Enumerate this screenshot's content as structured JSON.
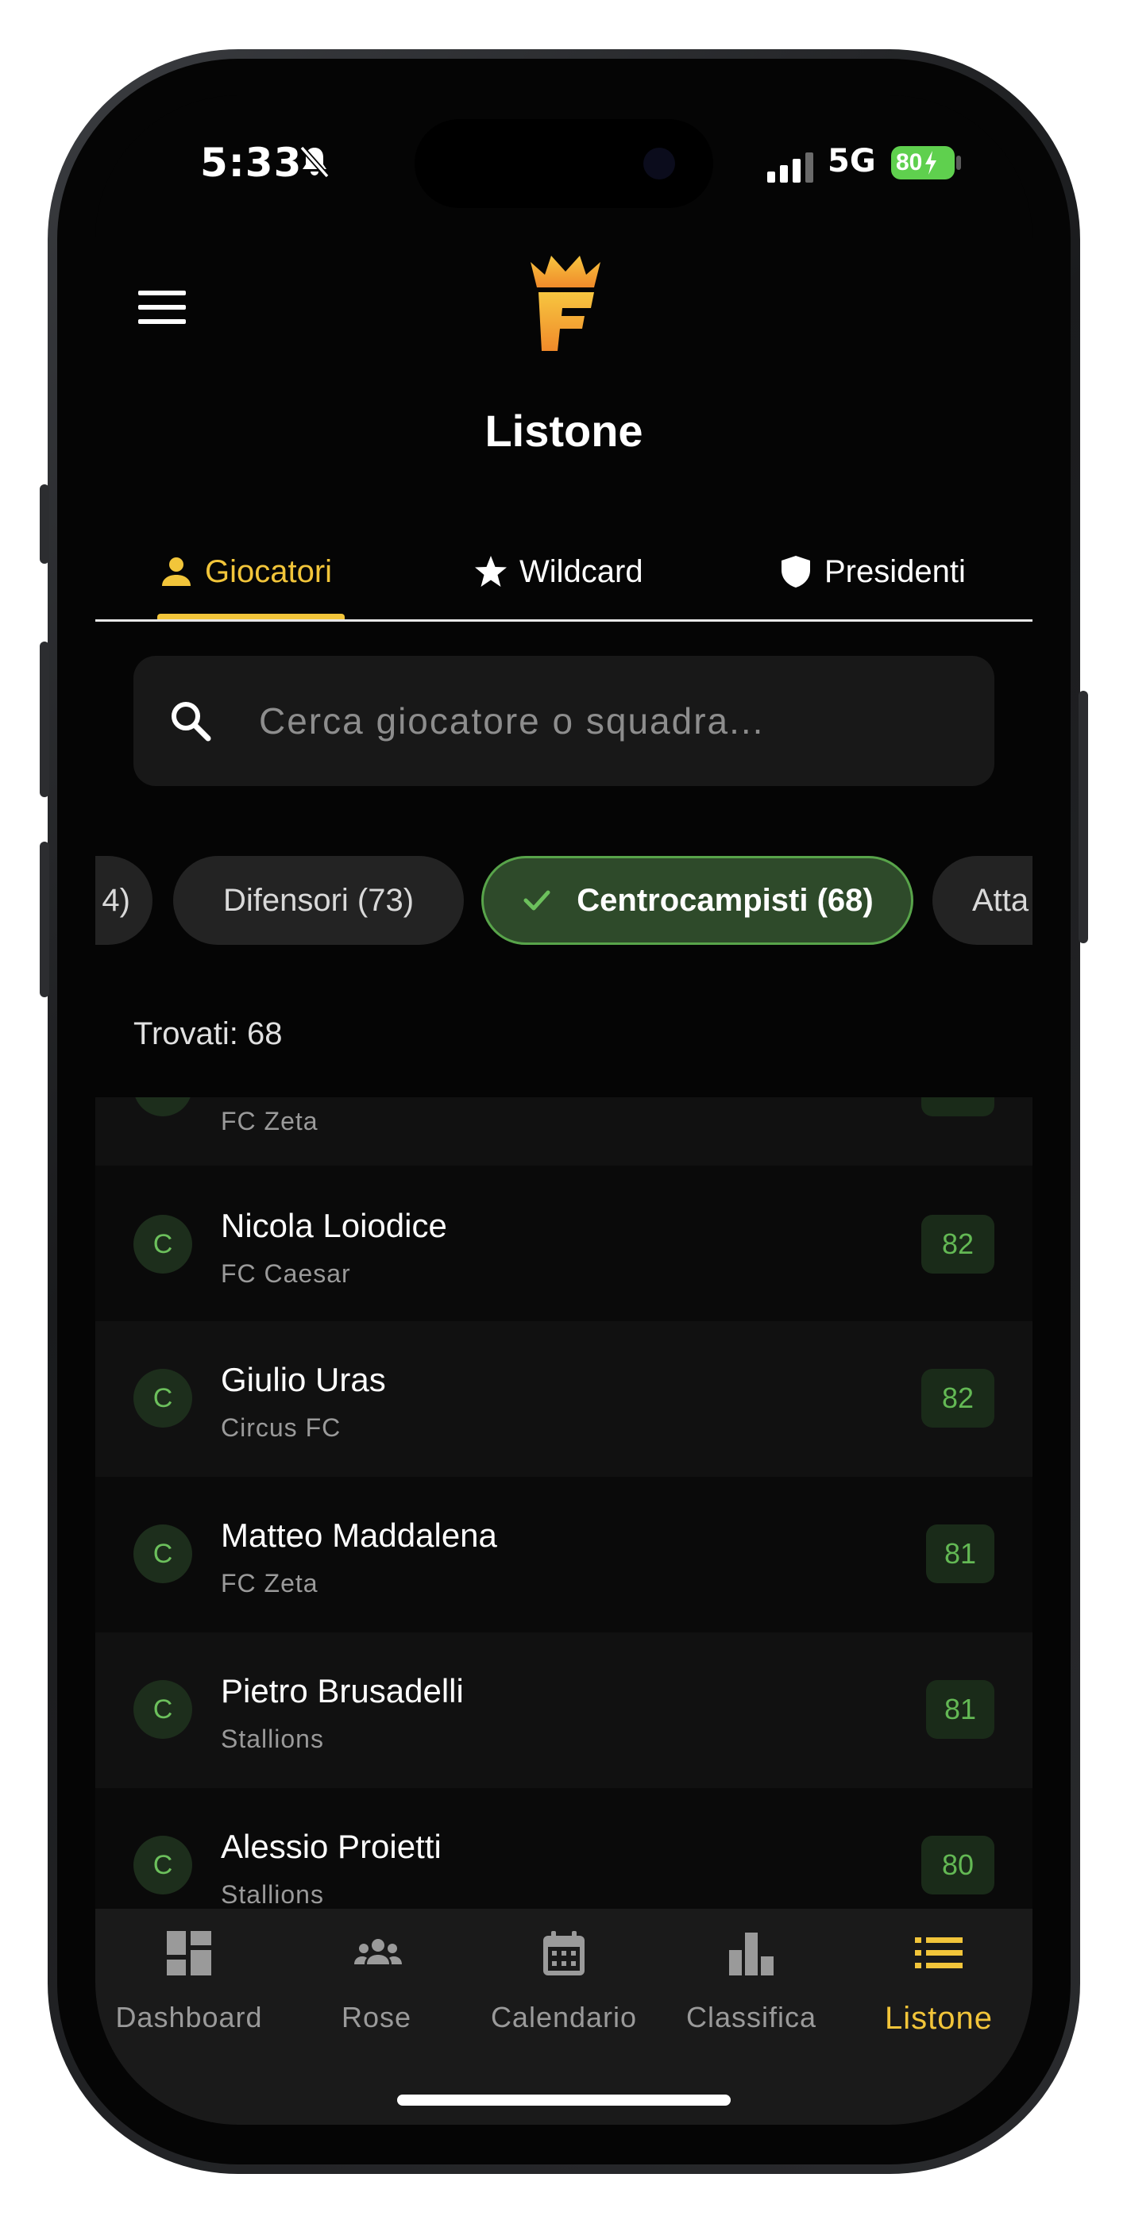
{
  "status_bar": {
    "time": "5:33",
    "network": "5G",
    "battery": "80"
  },
  "header": {
    "title": "Listone"
  },
  "tabs": [
    {
      "label": "Giocatori",
      "icon": "person-icon",
      "active": true
    },
    {
      "label": "Wildcard",
      "icon": "star-icon",
      "active": false
    },
    {
      "label": "Presidenti",
      "icon": "shield-icon",
      "active": false
    }
  ],
  "search": {
    "placeholder": "Cerca giocatore o squadra...",
    "value": ""
  },
  "filters": [
    {
      "label": "4)",
      "active": false
    },
    {
      "label": "Difensori (73)",
      "active": false
    },
    {
      "label": "Centrocampisti (68)",
      "active": true
    },
    {
      "label": "Atta",
      "active": false
    }
  ],
  "results": {
    "found_label": "Trovati: 68"
  },
  "players": [
    {
      "role": "C",
      "name": "",
      "team": "FC Zeta",
      "score": ""
    },
    {
      "role": "C",
      "name": "Nicola Loiodice",
      "team": "FC Caesar",
      "score": "82"
    },
    {
      "role": "C",
      "name": "Giulio Uras",
      "team": "Circus FC",
      "score": "82"
    },
    {
      "role": "C",
      "name": "Matteo Maddalena",
      "team": "FC Zeta",
      "score": "81"
    },
    {
      "role": "C",
      "name": "Pietro Brusadelli",
      "team": "Stallions",
      "score": "81"
    },
    {
      "role": "C",
      "name": "Alessio Proietti",
      "team": "Stallions",
      "score": "80"
    }
  ],
  "bottom_nav": [
    {
      "label": "Dashboard",
      "icon": "dashboard-icon"
    },
    {
      "label": "Rose",
      "icon": "group-icon"
    },
    {
      "label": "Calendario",
      "icon": "calendar-icon"
    },
    {
      "label": "Classifica",
      "icon": "bar-chart-icon"
    },
    {
      "label": "Listone",
      "icon": "list-icon",
      "active": true
    }
  ],
  "colors": {
    "accent": "#f2c53a",
    "green": "#63b854",
    "background": "#0a0a0a"
  }
}
